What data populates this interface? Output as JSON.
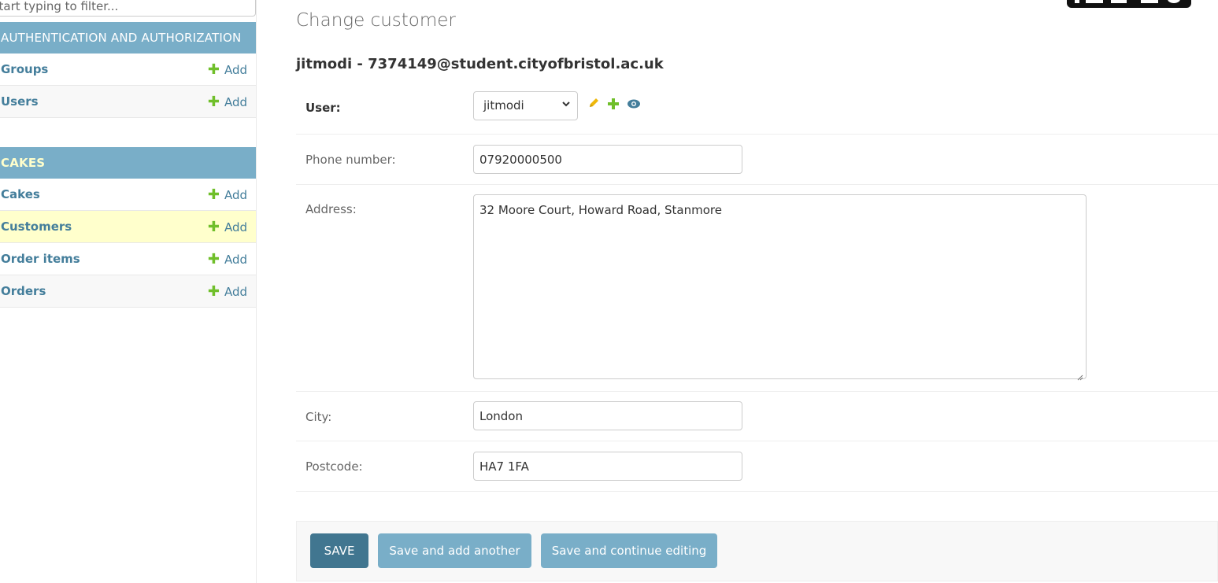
{
  "sidebar": {
    "filter_placeholder": "Start typing to filter...",
    "modules": [
      {
        "name": "AUTHENTICATION AND AUTHORIZATION",
        "models": [
          {
            "name": "Groups",
            "add_label": "Add"
          },
          {
            "name": "Users",
            "add_label": "Add"
          }
        ]
      },
      {
        "name": "CAKES",
        "models": [
          {
            "name": "Cakes",
            "add_label": "Add"
          },
          {
            "name": "Customers",
            "add_label": "Add",
            "selected": true
          },
          {
            "name": "Order items",
            "add_label": "Add"
          },
          {
            "name": "Orders",
            "add_label": "Add"
          }
        ]
      }
    ]
  },
  "main": {
    "page_title": "Change customer",
    "object_title": "jitmodi - 7374149@student.cityofbristol.ac.uk",
    "fields": {
      "user": {
        "label": "User:",
        "value": "jitmodi"
      },
      "phone": {
        "label": "Phone number:",
        "value": "07920000500"
      },
      "address": {
        "label": "Address:",
        "value": "32 Moore Court, Howard Road, Stanmore"
      },
      "city": {
        "label": "City:",
        "value": "London"
      },
      "postcode": {
        "label": "Postcode:",
        "value": "HA7 1FA"
      }
    },
    "buttons": {
      "save": "SAVE",
      "save_add_another": "Save and add another",
      "save_continue": "Save and continue editing"
    }
  },
  "colors": {
    "module_header": "#79aec8",
    "link": "#447e9b",
    "add_plus": "#70bf2b",
    "selected_row": "#ffffcc",
    "save_button": "#417690",
    "secondary_button": "#79aec8"
  },
  "icons": [
    "pencil-icon",
    "plus-icon",
    "eye-icon",
    "chevron-down-icon"
  ]
}
